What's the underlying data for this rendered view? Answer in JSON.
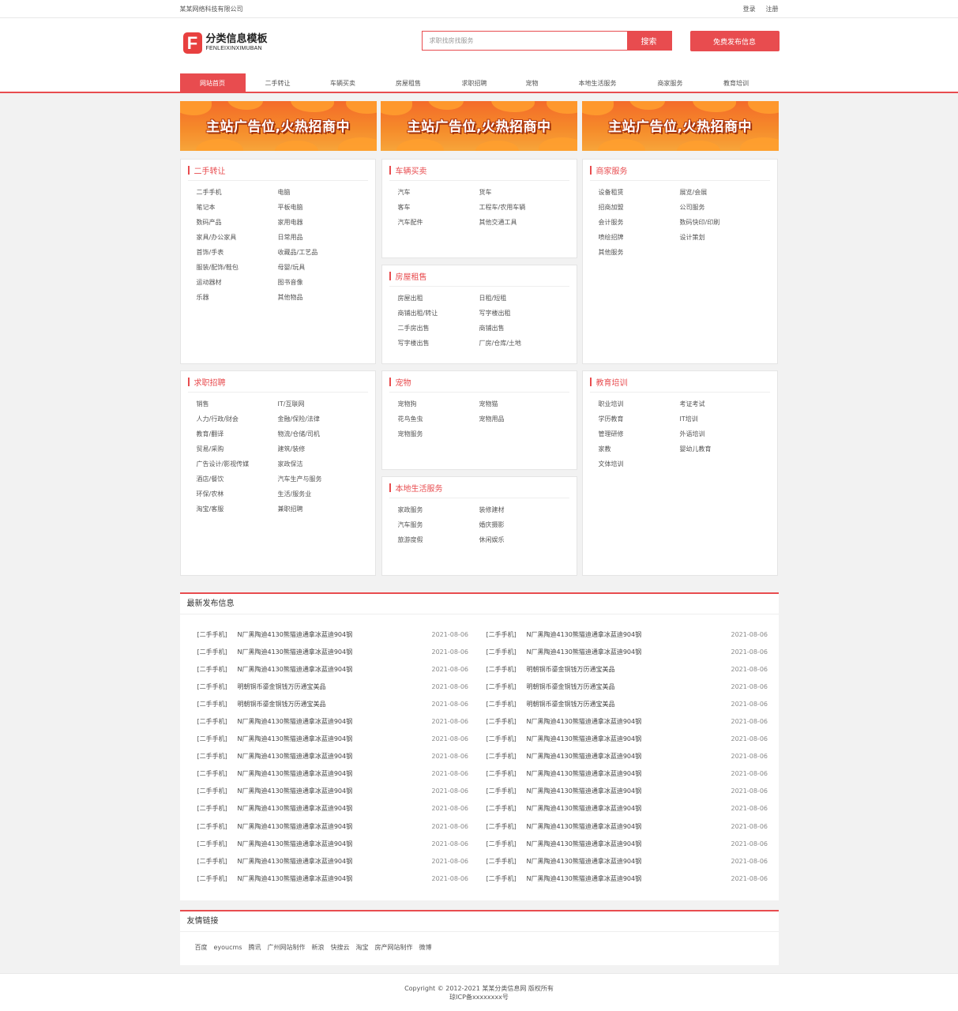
{
  "topbar": {
    "company": "某某网络科技有限公司",
    "login": "登录",
    "register": "注册"
  },
  "logo": {
    "letter": "F",
    "cn": "分类信息模板",
    "en": "FENLEIXINXIMUBAN"
  },
  "search": {
    "placeholder": "求职找房找服务",
    "button": "搜索"
  },
  "publish": "免费发布信息",
  "nav": [
    "网站首页",
    "二手转让",
    "车辆买卖",
    "房屋租售",
    "求职招聘",
    "宠物",
    "本地生活服务",
    "商家服务",
    "教育培训"
  ],
  "banners": [
    "主站广告位,火热招商中",
    "主站广告位,火热招商中",
    "主站广告位,火热招商中"
  ],
  "categories": [
    {
      "title": "二手转让",
      "items": [
        "二手手机",
        "电脑",
        "笔记本",
        "平板电脑",
        "数码产品",
        "家用电器",
        "家具/办公家具",
        "日常用品",
        "首饰/手表",
        "收藏品/工艺品",
        "服装/配饰/鞋包",
        "母婴/玩具",
        "运动器材",
        "图书音像",
        "乐器",
        "其他物品"
      ]
    },
    {
      "title": "车辆买卖",
      "items": [
        "汽车",
        "货车",
        "客车",
        "工程车/农用车辆",
        "汽车配件",
        "其他交通工具"
      ]
    },
    {
      "title": "商家服务",
      "items": [
        "设备租赁",
        "展览/会展",
        "招商加盟",
        "公司服务",
        "会计服务",
        "数码快印/印刷",
        "喷绘招牌",
        "设计策划",
        "其他服务"
      ]
    },
    {
      "title": "房屋租售",
      "items": [
        "房屋出租",
        "日租/短租",
        "商铺出租/转让",
        "写字楼出租",
        "二手房出售",
        "商铺出售",
        "写字楼出售",
        "厂房/仓库/土地"
      ]
    },
    {
      "title": "求职招聘",
      "items": [
        "销售",
        "IT/互联网",
        "人力/行政/财会",
        "金融/保险/法律",
        "教育/翻译",
        "物流/仓储/司机",
        "贸易/采购",
        "建筑/装修",
        "广告设计/影视传媒",
        "家政保洁",
        "酒店/餐饮",
        "汽车生产与服务",
        "环保/农林",
        "生活/服务业",
        "淘宝/客服",
        "兼职招聘"
      ]
    },
    {
      "title": "宠物",
      "items": [
        "宠物狗",
        "宠物猫",
        "花鸟鱼虫",
        "宠物用品",
        "宠物服务"
      ]
    },
    {
      "title": "教育培训",
      "items": [
        "职业培训",
        "考证考试",
        "学历教育",
        "IT培训",
        "管理研修",
        "外语培训",
        "家教",
        "婴幼儿教育",
        "文体培训"
      ]
    },
    {
      "title": "本地生活服务",
      "items": [
        "家政服务",
        "装修建材",
        "汽车服务",
        "婚庆摄影",
        "旅游度假",
        "休闲娱乐"
      ]
    }
  ],
  "latest": {
    "title": "最新发布信息",
    "rows": [
      [
        {
          "cat": "[二手手机]",
          "title": "N厂黑陶迪4130熊猫迪通拿冰蓝迪904钢",
          "date": "2021-08-06"
        },
        {
          "cat": "[二手手机]",
          "title": "N厂黑陶迪4130熊猫迪通拿冰蓝迪904钢",
          "date": "2021-08-06"
        }
      ],
      [
        {
          "cat": "[二手手机]",
          "title": "N厂黑陶迪4130熊猫迪通拿冰蓝迪904钢",
          "date": "2021-08-06"
        },
        {
          "cat": "[二手手机]",
          "title": "N厂黑陶迪4130熊猫迪通拿冰蓝迪904钢",
          "date": "2021-08-06"
        }
      ],
      [
        {
          "cat": "[二手手机]",
          "title": "N厂黑陶迪4130熊猫迪通拿冰蓝迪904钢",
          "date": "2021-08-06"
        },
        {
          "cat": "[二手手机]",
          "title": "明朝铜币鎏金铜钱万历通宝美品",
          "date": "2021-08-06"
        }
      ],
      [
        {
          "cat": "[二手手机]",
          "title": "明朝铜币鎏金铜钱万历通宝美品",
          "date": "2021-08-06"
        },
        {
          "cat": "[二手手机]",
          "title": "明朝铜币鎏金铜钱万历通宝美品",
          "date": "2021-08-06"
        }
      ],
      [
        {
          "cat": "[二手手机]",
          "title": "明朝铜币鎏金铜钱万历通宝美品",
          "date": "2021-08-06"
        },
        {
          "cat": "[二手手机]",
          "title": "明朝铜币鎏金铜钱万历通宝美品",
          "date": "2021-08-06"
        }
      ],
      [
        {
          "cat": "[二手手机]",
          "title": "N厂黑陶迪4130熊猫迪通拿冰蓝迪904钢",
          "date": "2021-08-06"
        },
        {
          "cat": "[二手手机]",
          "title": "N厂黑陶迪4130熊猫迪通拿冰蓝迪904钢",
          "date": "2021-08-06"
        }
      ],
      [
        {
          "cat": "[二手手机]",
          "title": "N厂黑陶迪4130熊猫迪通拿冰蓝迪904钢",
          "date": "2021-08-06"
        },
        {
          "cat": "[二手手机]",
          "title": "N厂黑陶迪4130熊猫迪通拿冰蓝迪904钢",
          "date": "2021-08-06"
        }
      ],
      [
        {
          "cat": "[二手手机]",
          "title": "N厂黑陶迪4130熊猫迪通拿冰蓝迪904钢",
          "date": "2021-08-06"
        },
        {
          "cat": "[二手手机]",
          "title": "N厂黑陶迪4130熊猫迪通拿冰蓝迪904钢",
          "date": "2021-08-06"
        }
      ],
      [
        {
          "cat": "[二手手机]",
          "title": "N厂黑陶迪4130熊猫迪通拿冰蓝迪904钢",
          "date": "2021-08-06"
        },
        {
          "cat": "[二手手机]",
          "title": "N厂黑陶迪4130熊猫迪通拿冰蓝迪904钢",
          "date": "2021-08-06"
        }
      ],
      [
        {
          "cat": "[二手手机]",
          "title": "N厂黑陶迪4130熊猫迪通拿冰蓝迪904钢",
          "date": "2021-08-06"
        },
        {
          "cat": "[二手手机]",
          "title": "N厂黑陶迪4130熊猫迪通拿冰蓝迪904钢",
          "date": "2021-08-06"
        }
      ],
      [
        {
          "cat": "[二手手机]",
          "title": "N厂黑陶迪4130熊猫迪通拿冰蓝迪904钢",
          "date": "2021-08-06"
        },
        {
          "cat": "[二手手机]",
          "title": "N厂黑陶迪4130熊猫迪通拿冰蓝迪904钢",
          "date": "2021-08-06"
        }
      ],
      [
        {
          "cat": "[二手手机]",
          "title": "N厂黑陶迪4130熊猫迪通拿冰蓝迪904钢",
          "date": "2021-08-06"
        },
        {
          "cat": "[二手手机]",
          "title": "N厂黑陶迪4130熊猫迪通拿冰蓝迪904钢",
          "date": "2021-08-06"
        }
      ],
      [
        {
          "cat": "[二手手机]",
          "title": "N厂黑陶迪4130熊猫迪通拿冰蓝迪904钢",
          "date": "2021-08-06"
        },
        {
          "cat": "[二手手机]",
          "title": "N厂黑陶迪4130熊猫迪通拿冰蓝迪904钢",
          "date": "2021-08-06"
        }
      ],
      [
        {
          "cat": "[二手手机]",
          "title": "N厂黑陶迪4130熊猫迪通拿冰蓝迪904钢",
          "date": "2021-08-06"
        },
        {
          "cat": "[二手手机]",
          "title": "N厂黑陶迪4130熊猫迪通拿冰蓝迪904钢",
          "date": "2021-08-06"
        }
      ],
      [
        {
          "cat": "[二手手机]",
          "title": "N厂黑陶迪4130熊猫迪通拿冰蓝迪904钢",
          "date": "2021-08-06"
        },
        {
          "cat": "[二手手机]",
          "title": "N厂黑陶迪4130熊猫迪通拿冰蓝迪904钢",
          "date": "2021-08-06"
        }
      ]
    ]
  },
  "friends": {
    "title": "友情链接",
    "links": [
      "百度",
      "eyoucms",
      "腾讯",
      "广州网站制作",
      "新浪",
      "快搜云",
      "淘宝",
      "房产网站制作",
      "微博"
    ]
  },
  "footer": {
    "copyright": "Copyright © 2012-2021 某某分类信息网 版权所有",
    "icp": "琼ICP备xxxxxxxx号"
  },
  "colors": {
    "accent": "#e84c4f",
    "background": "#f2f2f2"
  }
}
